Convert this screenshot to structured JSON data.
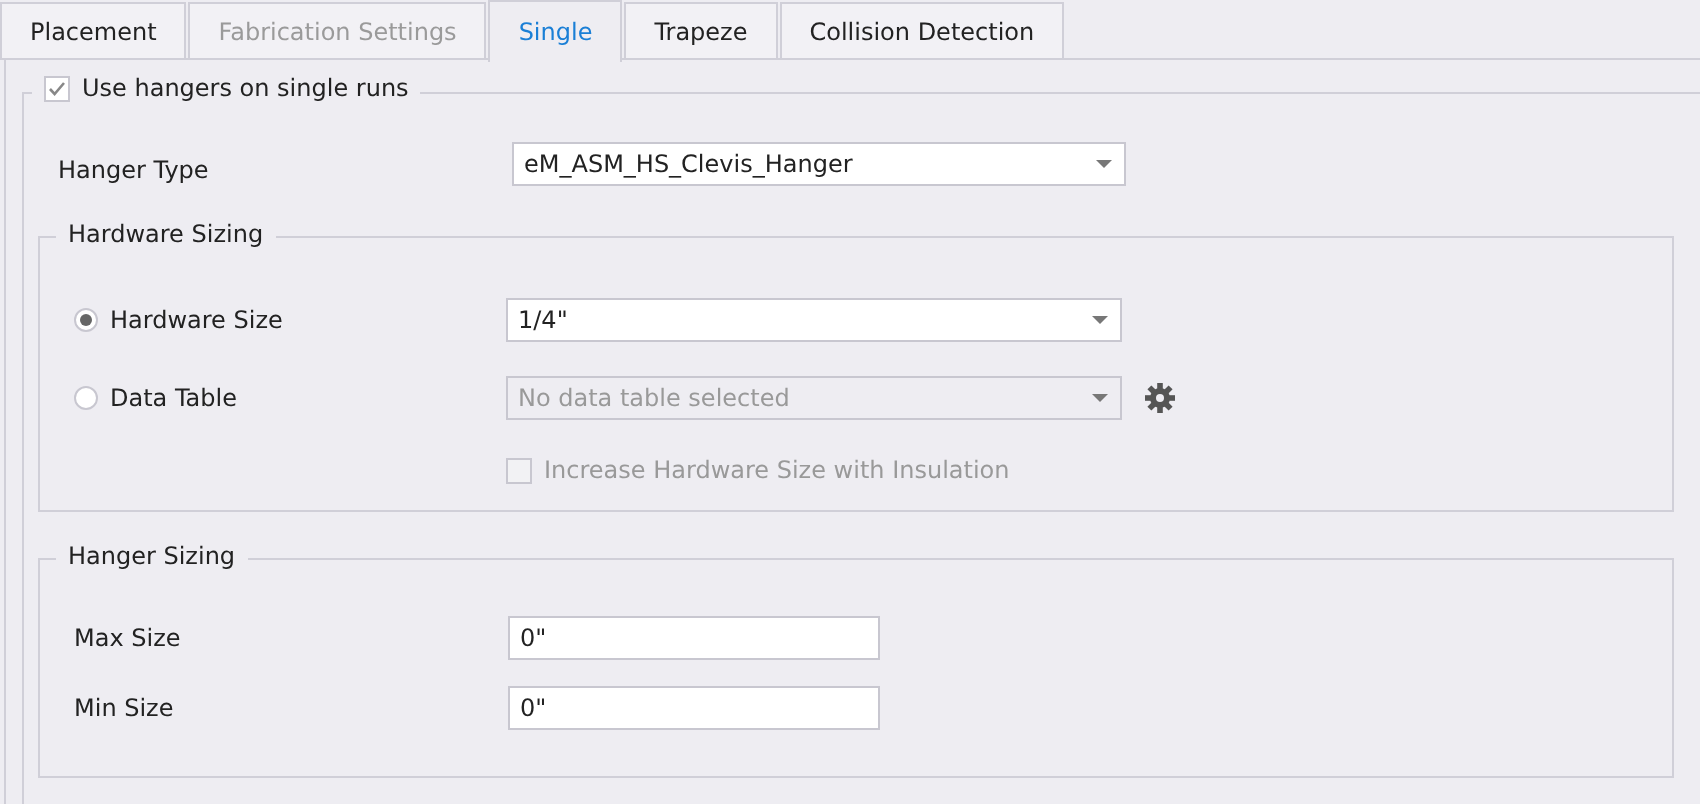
{
  "tabs": [
    {
      "label": "Placement",
      "selected": false,
      "disabled": false
    },
    {
      "label": "Fabrication Settings",
      "selected": false,
      "disabled": true
    },
    {
      "label": "Single",
      "selected": true,
      "disabled": false
    },
    {
      "label": "Trapeze",
      "selected": false,
      "disabled": false
    },
    {
      "label": "Collision Detection",
      "selected": false,
      "disabled": false
    }
  ],
  "use_hangers": {
    "label": "Use hangers on single runs",
    "checked": true
  },
  "hanger_type": {
    "label": "Hanger Type",
    "value": "eM_ASM_HS_Clevis_Hanger"
  },
  "hardware_sizing": {
    "title": "Hardware Sizing",
    "options": [
      {
        "label": "Hardware Size",
        "selected": true,
        "value": "1/4\"",
        "disabled": false,
        "settings": false
      },
      {
        "label": "Data Table",
        "selected": false,
        "value": "No data table selected",
        "disabled": true,
        "settings": true
      }
    ],
    "insulation": {
      "label": "Increase Hardware Size with Insulation",
      "checked": false,
      "disabled": true
    }
  },
  "hanger_sizing": {
    "title": "Hanger Sizing",
    "fields": [
      {
        "label": "Max Size",
        "value": "0\""
      },
      {
        "label": "Min Size",
        "value": "0\""
      }
    ]
  }
}
